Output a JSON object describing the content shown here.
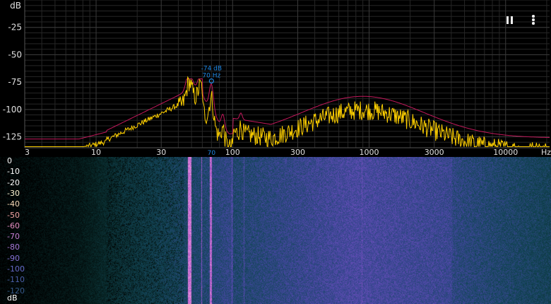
{
  "spectrum": {
    "y_unit_label": "dB",
    "y_ticks": [
      {
        "label": "-25",
        "value": -25
      },
      {
        "label": "-50",
        "value": -50
      },
      {
        "label": "-75",
        "value": -75
      },
      {
        "label": "-100",
        "value": -100
      },
      {
        "label": "-125",
        "value": -125
      }
    ],
    "x_unit_label": "Hz",
    "x_ticks": [
      {
        "label": "3",
        "value": 3
      },
      {
        "label": "10",
        "value": 10
      },
      {
        "label": "30",
        "value": 30
      },
      {
        "label": "100",
        "value": 100
      },
      {
        "label": "300",
        "value": 300
      },
      {
        "label": "1000",
        "value": 1000
      },
      {
        "label": "3000",
        "value": 3000
      },
      {
        "label": "10000",
        "value": 10000
      }
    ],
    "ylim": [
      -135,
      0
    ],
    "xlim": [
      3,
      21000
    ],
    "x_scale": "log",
    "grid": true,
    "peak": {
      "db_label": "-74 dB",
      "hz_label": "70 Hz",
      "axis_label": "70",
      "freq": 70,
      "db": -74
    },
    "colors": {
      "peak_line": "#c2185b",
      "current_line": "#ffd000",
      "grid": "#3a3a3a",
      "peak_marker": "#1e88e5",
      "background": "#000000"
    }
  },
  "toolbar": {
    "pause_icon": "pause-icon",
    "menu_icon": "more-vert-icon"
  },
  "spectrogram": {
    "scale_unit_label": "dB",
    "scale_labels": [
      {
        "label": "0",
        "color": "#ffffff"
      },
      {
        "label": "-10",
        "color": "#ffffff"
      },
      {
        "label": "-20",
        "color": "#ffffff"
      },
      {
        "label": "-30",
        "color": "#fff3cf"
      },
      {
        "label": "-40",
        "color": "#f8d9b6"
      },
      {
        "label": "-50",
        "color": "#f2a3a3"
      },
      {
        "label": "-60",
        "color": "#e88fc4"
      },
      {
        "label": "-70",
        "color": "#c77fd6"
      },
      {
        "label": "-80",
        "color": "#a678d9"
      },
      {
        "label": "-90",
        "color": "#8470d4"
      },
      {
        "label": "-100",
        "color": "#6568c7"
      },
      {
        "label": "-110",
        "color": "#4b5fa8"
      },
      {
        "label": "-120",
        "color": "#365a8a"
      }
    ]
  }
}
